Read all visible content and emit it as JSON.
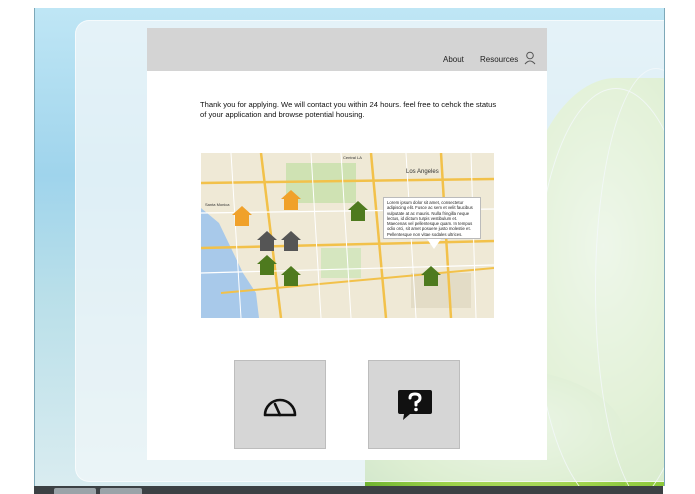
{
  "header": {
    "nav": [
      {
        "label": "About"
      },
      {
        "label": "Resources"
      }
    ],
    "user_icon": "user-icon"
  },
  "main": {
    "message": "Thank you for applying. We will contact you within 24 hours. feel free to cehck the status of your application and browse potential housing."
  },
  "map": {
    "labels": {
      "los_angeles": "Los Angeles",
      "santa_monica": "Santa Monica",
      "central_la": "Central LA"
    },
    "popup_text": "Lorem ipsum dolor sit amet, consectetur adipiscing elit. Fusce ac sem et velit faucibus vulputate at ac mauris. Nulla fringilla neque lectus, id dictum turpis vestibulum et. Maecenas vel pellentesque quam. In tempus odio orci, sit amet posuere justo molestie et. Pellentesque non vitae sodales ultrices.",
    "markers": [
      {
        "color": "#f0a12a",
        "status": "available"
      },
      {
        "color": "#f0a12a",
        "status": "available"
      },
      {
        "color": "#4e7a1e",
        "status": "selected"
      },
      {
        "color": "#555555",
        "status": "unavailable"
      },
      {
        "color": "#555555",
        "status": "unavailable"
      },
      {
        "color": "#4e7a1e",
        "status": "selected"
      },
      {
        "color": "#4e7a1e",
        "status": "selected"
      },
      {
        "color": "#4e7a1e",
        "status": "selected"
      }
    ]
  },
  "tiles": [
    {
      "icon": "dashboard-gauge-icon"
    },
    {
      "icon": "help-question-icon"
    }
  ],
  "colors": {
    "header_bg": "#d4d4d4",
    "tile_bg": "#d6d6d6",
    "orange": "#f0a12a",
    "green": "#4e7a1e",
    "gray": "#555555"
  }
}
